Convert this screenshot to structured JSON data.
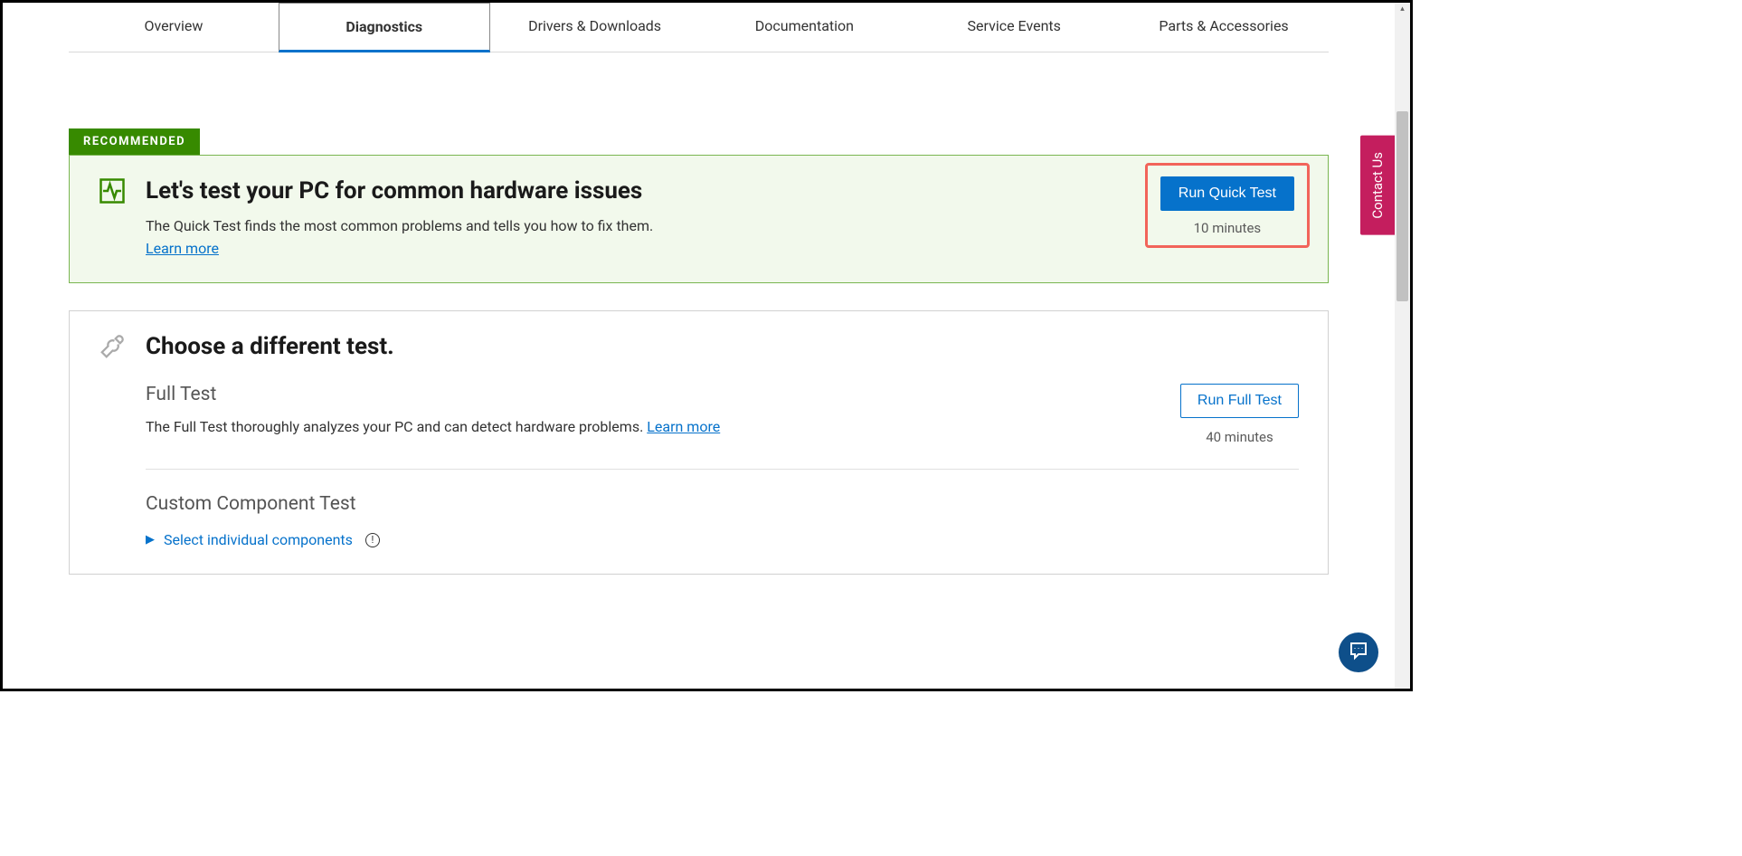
{
  "tabs": {
    "items": [
      {
        "label": "Overview"
      },
      {
        "label": "Diagnostics"
      },
      {
        "label": "Drivers & Downloads"
      },
      {
        "label": "Documentation"
      },
      {
        "label": "Service Events"
      },
      {
        "label": "Parts & Accessories"
      }
    ],
    "active_index": 1
  },
  "recommended": {
    "tag": "RECOMMENDED",
    "title": "Let's test your PC for common hardware issues",
    "description": "The Quick Test finds the most common problems and tells you how to fix them.",
    "learn_more": "Learn more",
    "button": "Run Quick Test",
    "duration": "10 minutes"
  },
  "other": {
    "title": "Choose a different test.",
    "full_test": {
      "name": "Full Test",
      "description": "The Full Test thoroughly analyzes your PC and can detect hardware problems. ",
      "learn_more": "Learn more",
      "button": "Run Full Test",
      "duration": "40 minutes"
    },
    "custom": {
      "name": "Custom Component Test",
      "expand_label": "Select individual components",
      "info_glyph": "!"
    }
  },
  "contact_label": "Contact Us"
}
